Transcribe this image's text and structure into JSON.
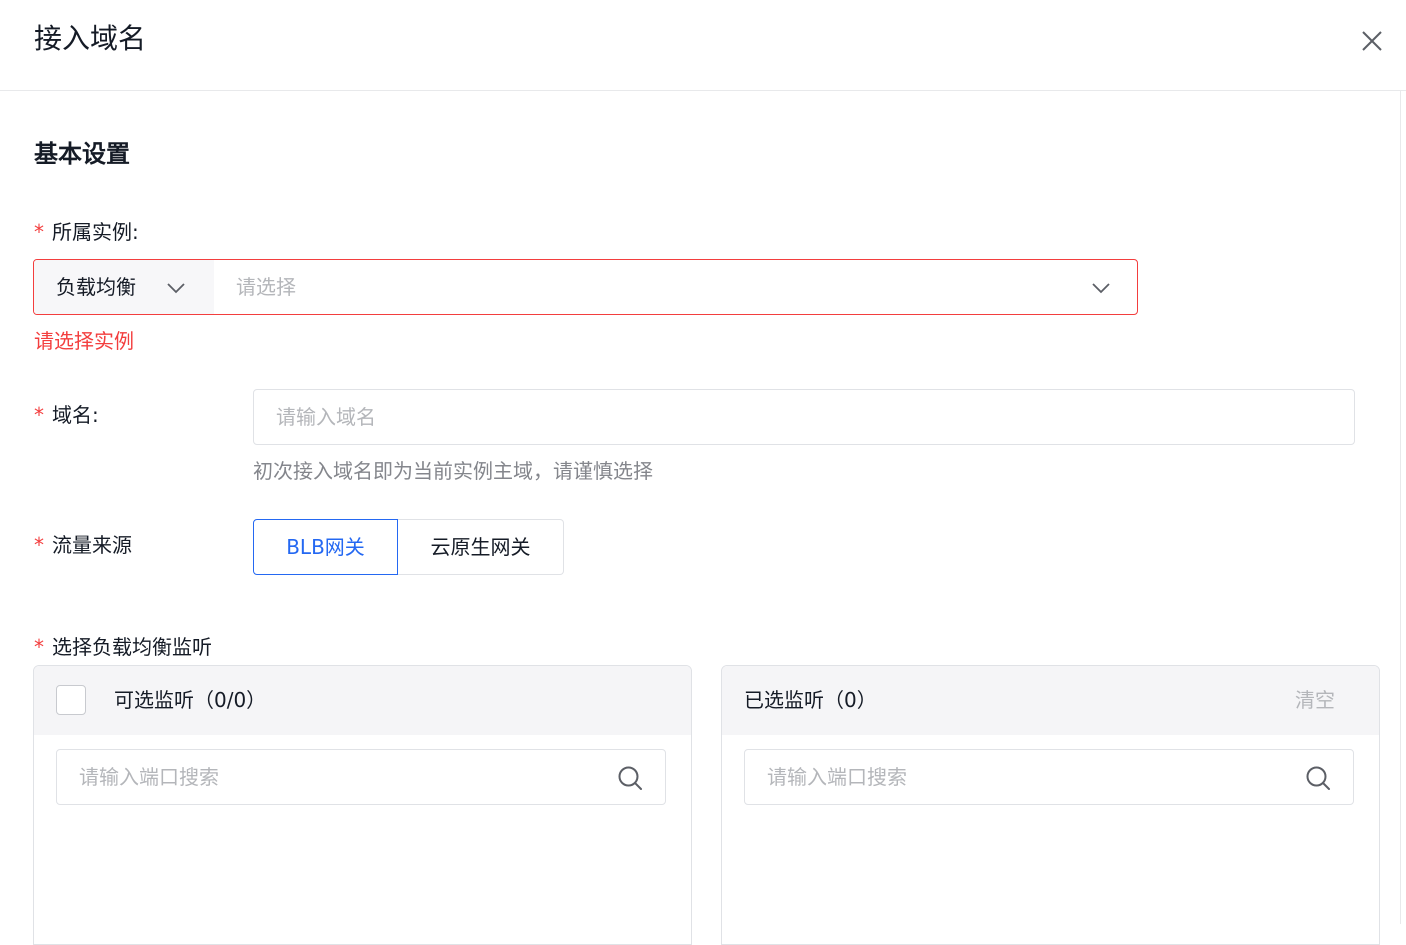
{
  "dialog": {
    "title": "接入域名"
  },
  "section": {
    "title": "基本设置"
  },
  "instance": {
    "label": "所属实例:",
    "required_mark": "*",
    "type_value": "负载均衡",
    "select_placeholder": "请选择",
    "error": "请选择实例"
  },
  "domain": {
    "label": "域名:",
    "required_mark": "*",
    "placeholder": "请输入域名",
    "hint": "初次接入域名即为当前实例主域，请谨慎选择"
  },
  "traffic_source": {
    "label": "流量来源",
    "required_mark": "*",
    "options": [
      "BLB网关",
      "云原生网关"
    ],
    "selected": "BLB网关"
  },
  "listener": {
    "label": "选择负载均衡监听",
    "required_mark": "*",
    "available": {
      "title": "可选监听（0/0）",
      "search_placeholder": "请输入端口搜索"
    },
    "selected": {
      "title": "已选监听（0）",
      "clear_label": "清空",
      "search_placeholder": "请输入端口搜索"
    }
  },
  "colors": {
    "primary": "#2468f2",
    "error": "#f33e3e",
    "text": "#151b26",
    "placeholder": "#b4b6ba",
    "hint": "#84868c",
    "border": "#e0e2e6"
  }
}
